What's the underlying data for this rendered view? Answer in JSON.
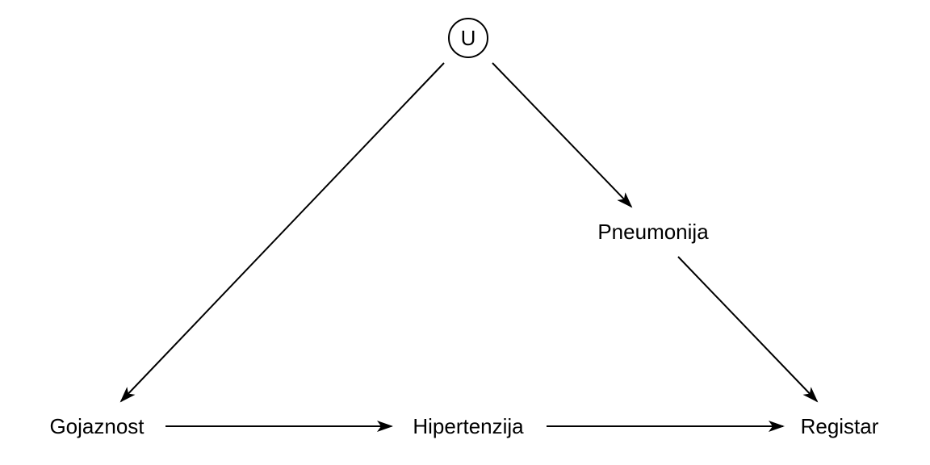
{
  "diagram": {
    "type": "directed-acyclic-graph",
    "nodes": {
      "u": {
        "label": "U",
        "latent": true
      },
      "gojaznost": {
        "label": "Gojaznost",
        "latent": false
      },
      "hipertenzija": {
        "label": "Hipertenzija",
        "latent": false
      },
      "registar": {
        "label": "Registar",
        "latent": false
      },
      "pneumonija": {
        "label": "Pneumonija",
        "latent": false
      }
    },
    "edges": [
      {
        "from": "U",
        "to": "Gojaznost"
      },
      {
        "from": "U",
        "to": "Pneumonija"
      },
      {
        "from": "Pneumonija",
        "to": "Registar"
      },
      {
        "from": "Gojaznost",
        "to": "Hipertenzija"
      },
      {
        "from": "Hipertenzija",
        "to": "Registar"
      }
    ]
  },
  "colors": {
    "stroke": "#000000",
    "background": "#ffffff"
  }
}
